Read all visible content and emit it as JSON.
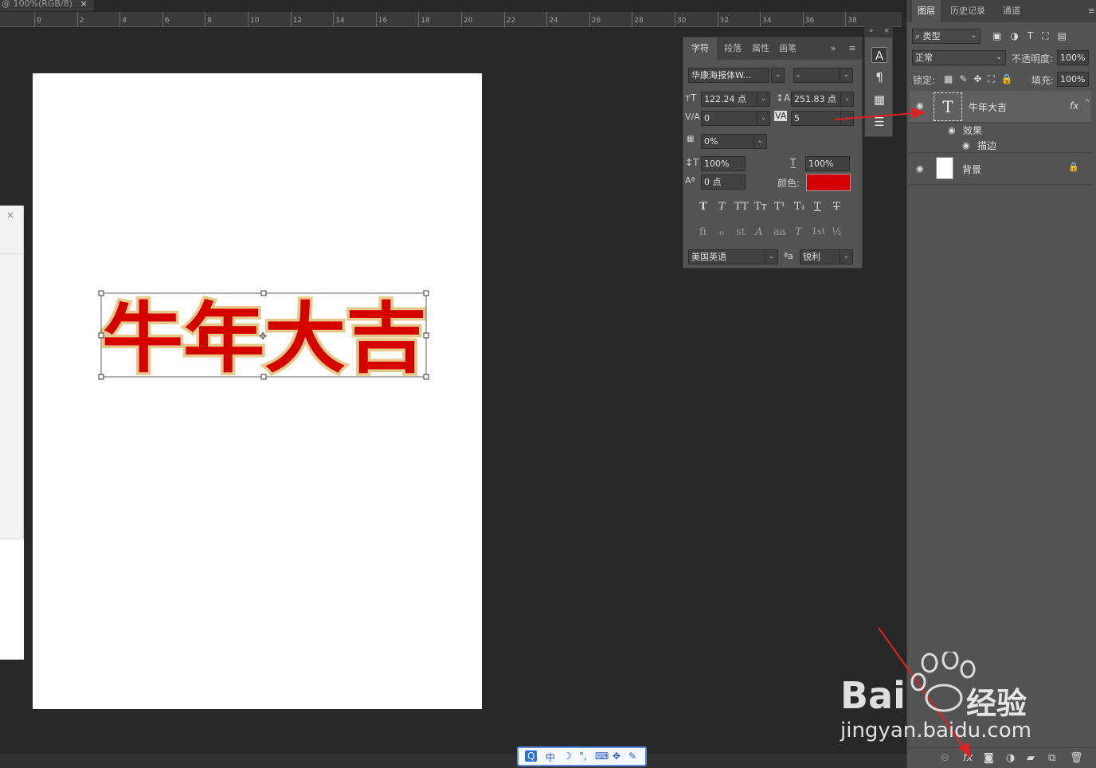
{
  "document": {
    "tab_title": "@ 100%(RGB/8)",
    "close_glyph": "×"
  },
  "ruler": {
    "ticks": [
      "0",
      "2",
      "4",
      "6",
      "8",
      "10",
      "12",
      "14",
      "16",
      "18",
      "20",
      "22",
      "24",
      "26",
      "28",
      "30",
      "32",
      "34",
      "36",
      "38"
    ]
  },
  "canvas": {
    "text": "牛年大吉",
    "text_fill": "#d40000",
    "text_stroke": "#e8c98a",
    "page_color": "#ffffff"
  },
  "left_dialog": {
    "close_glyph": "×"
  },
  "character_panel": {
    "tabs": [
      "字符",
      "段落",
      "属性",
      "画笔"
    ],
    "expand_glyph": "»",
    "font_family": "华康海报体W...",
    "font_style": "-",
    "font_size": "122.24 点",
    "leading": "251.83 点",
    "kerning": "0",
    "tracking": "5",
    "tsume": "0%",
    "vertical_scale": "100%",
    "horizontal_scale": "100%",
    "baseline_shift": "0 点",
    "color_label": "颜色:",
    "color_value": "#d40000",
    "style_buttons": [
      "T",
      "T",
      "TT",
      "Tт",
      "T¹",
      "T₁",
      "T",
      "T"
    ],
    "opentype_buttons": [
      "fi",
      "ℴ",
      "st",
      "A",
      "aa",
      "T",
      "1st",
      "½"
    ],
    "language": "美国英语",
    "aa_label": "ªa",
    "antialias": "锐利"
  },
  "layers_panel": {
    "tabs": [
      "图层",
      "历史记录",
      "通道"
    ],
    "filter_kind": "类型",
    "blend_mode": "正常",
    "opacity_label": "不透明度:",
    "opacity": "100%",
    "lock_label": "锁定:",
    "fill_label": "填充:",
    "fill": "100%",
    "layers": [
      {
        "name": "牛年大吉",
        "type": "text",
        "fx": "fx",
        "effects_label": "效果",
        "effects": [
          "描边"
        ]
      },
      {
        "name": "背景",
        "type": "background"
      }
    ]
  },
  "bottom_bar": {
    "fx_label": "fx"
  },
  "ime_bar": {
    "items": [
      "Q",
      "中",
      "☽",
      "°,",
      "⌨",
      "✥",
      "✎"
    ]
  },
  "watermark": {
    "brand": "Bai",
    "brand2": "经验",
    "url": "jingyan.baidu.com"
  }
}
